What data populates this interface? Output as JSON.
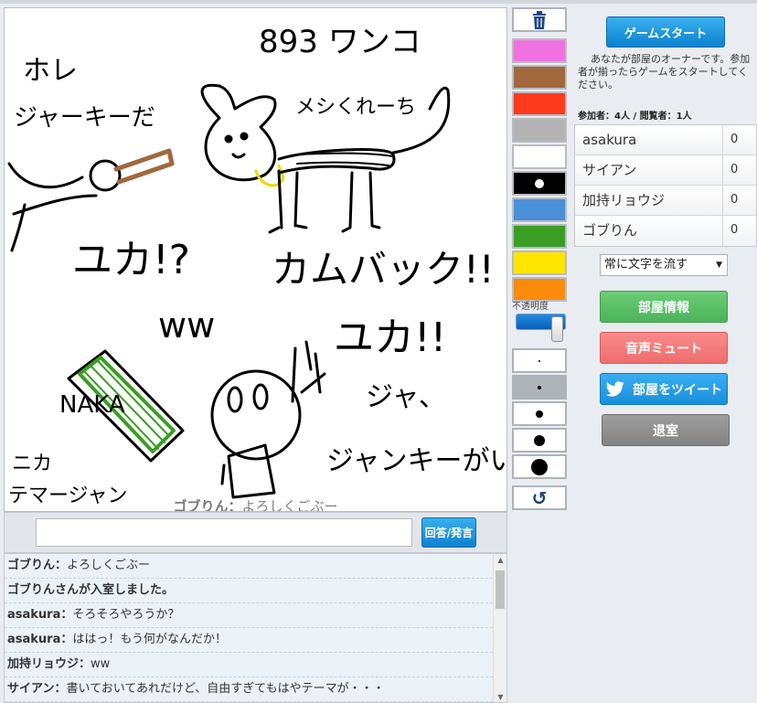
{
  "game": {
    "start_label": "ゲームスタート",
    "owner_note": "あなたが部屋のオーナーです。参加者が揃ったらゲームをスタートしてください。",
    "counts": "参加者：4人 / 閲覧者：1人"
  },
  "canvas": {
    "overlay_name": "ゴブりん：",
    "overlay_text": "よろしくごぶー",
    "drawn_texts": [
      "893 ワンコ",
      "ホレ",
      "ジャーキーだ",
      "メシくれーち",
      "ユカ!?",
      "ww",
      "カムバック!!",
      "ユカ!!",
      "NAKA",
      "ジャ、",
      "ジャンキーがいる!?",
      "ニカ",
      "テマージャン"
    ]
  },
  "players": [
    {
      "name": "asakura",
      "score": "0"
    },
    {
      "name": "サイアン",
      "score": "0"
    },
    {
      "name": "加持リョウジ",
      "score": "0"
    },
    {
      "name": "ゴブりん",
      "score": "0"
    }
  ],
  "flow_select": {
    "value": "常に文字を流す"
  },
  "buttons": {
    "room_info": "部屋情報",
    "mute": "音声ミュート",
    "tweet": "部屋をツイート",
    "exit": "退室",
    "answer": "回答/発言"
  },
  "tools": {
    "opacity_label": "不透明度",
    "opacity_level": 0.9,
    "colors": [
      "#f072e0",
      "#a0683c",
      "#fb3a1e",
      "#b3b3b3",
      "#ffffff",
      "#000000",
      "#4a90d9",
      "#3a9e24",
      "#ffe600",
      "#fb8b0c"
    ],
    "selected_color_index": 5
  },
  "chat": [
    {
      "name": "ゴブりん",
      "sep": "：",
      "text": "よろしくごぶー"
    },
    {
      "name": "ゴブりんさんが入室しました。",
      "sep": "",
      "text": ""
    },
    {
      "name": "asakura",
      "sep": "：",
      "text": "そろそろやろうか？"
    },
    {
      "name": "asakura",
      "sep": "：",
      "text": "ははっ！もう何がなんだか！"
    },
    {
      "name": "加持リョウジ",
      "sep": "：",
      "text": "ww"
    },
    {
      "name": "サイアン",
      "sep": "：",
      "text": "書いておいてあれだけど、自由すぎてもはやテーマが・・・"
    }
  ]
}
